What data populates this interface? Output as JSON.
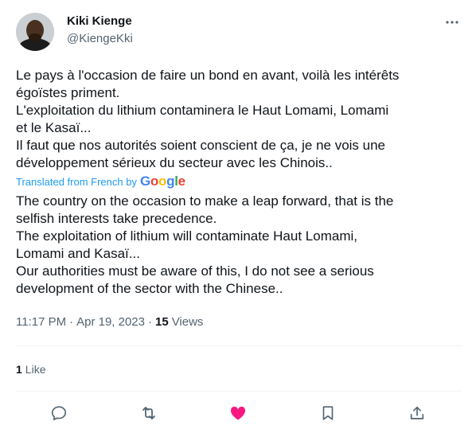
{
  "author": {
    "display_name": "Kiki Kienge",
    "handle": "@KiengeKki"
  },
  "tweet": {
    "text": "Le pays à l'occasion de faire un bond en avant, voilà les intérêts\négoïstes priment.\nL'exploitation du lithium contaminera le Haut Lomami, Lomami\net le Kasaï...\nIl faut que nos autorités soient conscient de ça, je ne vois une\ndéveloppement sérieux du secteur avec les Chinois..",
    "translated_label": "Translated from French by",
    "translator": "Google",
    "translation": "The country on the occasion to make a leap forward, that is the\nselfish interests take precedence.\nThe exploitation of lithium will contaminate Haut Lomami,\nLomami and Kasaï...\nOur authorities must be aware of this, I do not see a serious\ndevelopment of the sector with the Chinese.."
  },
  "meta": {
    "time": "11:17 PM",
    "separator": "·",
    "date": "Apr 19, 2023",
    "views_count": "15",
    "views_label": "Views"
  },
  "engagement": {
    "likes_count": "1",
    "likes_label": "Like"
  },
  "icons": [
    "more-icon",
    "reply-icon",
    "retweet-icon",
    "like-icon",
    "bookmark-icon",
    "share-icon"
  ],
  "colors": {
    "text": "#0f1419",
    "secondary": "#536471",
    "link": "#1d9bf0",
    "like_active": "#f91880",
    "divider": "#eff3f4"
  }
}
